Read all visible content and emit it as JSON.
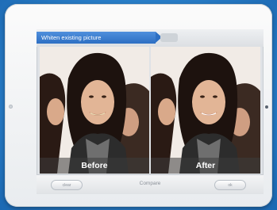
{
  "screen": {
    "title": "Whiten existing picture"
  },
  "photos": {
    "before_label": "Before",
    "after_label": "After"
  },
  "toolbar": {
    "left_button_label": "clear",
    "compare_label": "Compare",
    "right_button_label": "ok"
  },
  "colors": {
    "background": "#2a7fc9",
    "title_ribbon": "#2d6fc3"
  }
}
